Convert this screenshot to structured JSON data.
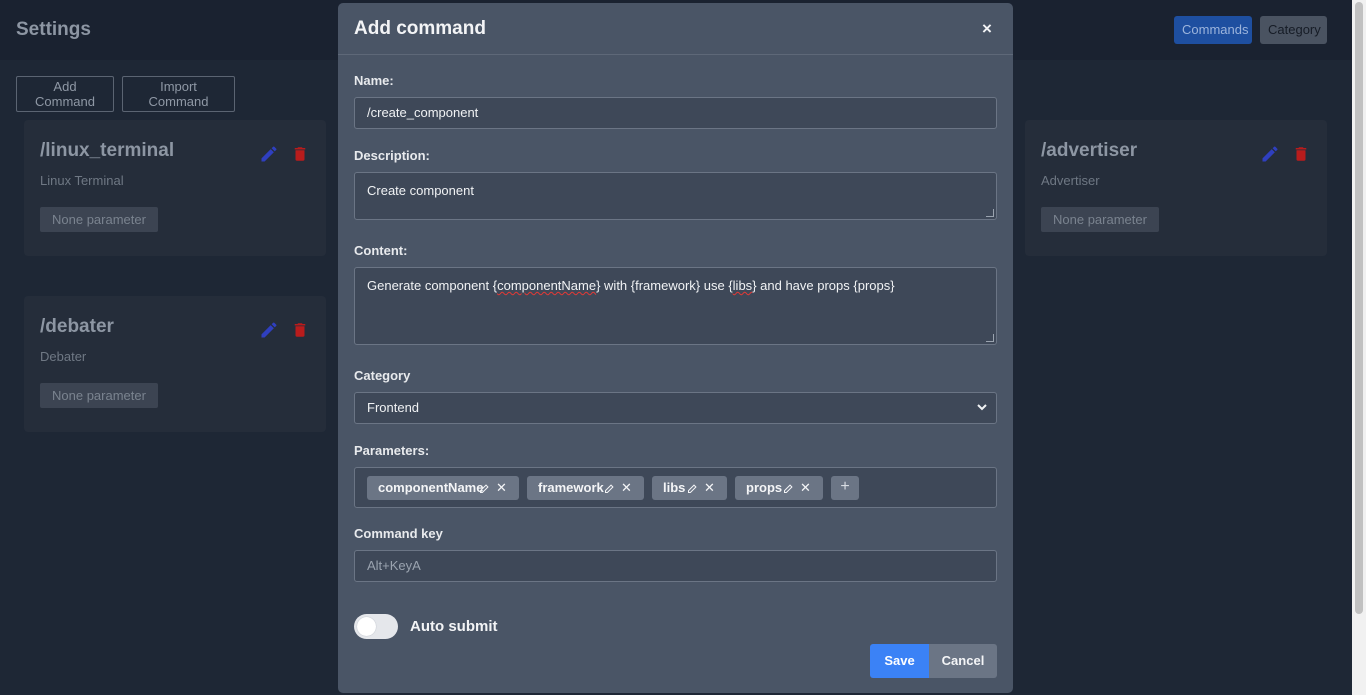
{
  "header": {
    "title": "Settings",
    "nav": {
      "commands": "Commands",
      "category": "Category"
    }
  },
  "toolbar": {
    "add_label": "Add Command",
    "import_label": "Import Command"
  },
  "cards": [
    {
      "title": "/linux_terminal",
      "description": "Linux Terminal",
      "param_label": "None parameter"
    },
    {
      "title": "/advertiser",
      "description": "Advertiser",
      "param_label": "None parameter"
    },
    {
      "title": "/debater",
      "description": "Debater",
      "param_label": "None parameter"
    }
  ],
  "colors": {
    "primary": "#3b82f6",
    "danger": "#e11d2b",
    "edit_icon": "#2f3fbf"
  },
  "modal": {
    "title": "Add command",
    "close_label": "×",
    "name_label": "Name:",
    "name_value": "/create_component",
    "description_label": "Description:",
    "description_value": "Create component",
    "content_label": "Content:",
    "content_parts": [
      "Generate component {",
      "componentName",
      "} with {framework} use {",
      "libs",
      "} and have props {props}"
    ],
    "category_label": "Category",
    "category_value": "Frontend",
    "parameters_label": "Parameters:",
    "parameters": [
      "componentName",
      "framework",
      "libs",
      "props"
    ],
    "add_param_label": "+",
    "command_key_label": "Command key",
    "command_key_placeholder": "Alt+KeyA",
    "auto_submit_label": "Auto submit",
    "auto_submit_on": false,
    "save_label": "Save",
    "cancel_label": "Cancel"
  }
}
